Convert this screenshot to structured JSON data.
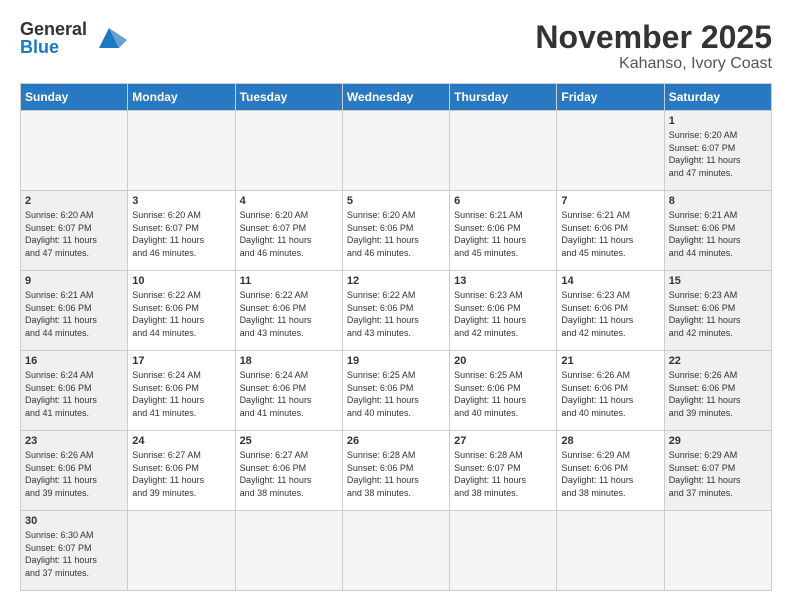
{
  "header": {
    "logo_line1": "General",
    "logo_line2": "Blue",
    "title": "November 2025",
    "subtitle": "Kahanso, Ivory Coast"
  },
  "days_of_week": [
    "Sunday",
    "Monday",
    "Tuesday",
    "Wednesday",
    "Thursday",
    "Friday",
    "Saturday"
  ],
  "weeks": [
    [
      {
        "day": "",
        "info": ""
      },
      {
        "day": "",
        "info": ""
      },
      {
        "day": "",
        "info": ""
      },
      {
        "day": "",
        "info": ""
      },
      {
        "day": "",
        "info": ""
      },
      {
        "day": "",
        "info": ""
      },
      {
        "day": "1",
        "info": "Sunrise: 6:20 AM\nSunset: 6:07 PM\nDaylight: 11 hours\nand 47 minutes."
      }
    ],
    [
      {
        "day": "2",
        "info": "Sunrise: 6:20 AM\nSunset: 6:07 PM\nDaylight: 11 hours\nand 47 minutes."
      },
      {
        "day": "3",
        "info": "Sunrise: 6:20 AM\nSunset: 6:07 PM\nDaylight: 11 hours\nand 46 minutes."
      },
      {
        "day": "4",
        "info": "Sunrise: 6:20 AM\nSunset: 6:07 PM\nDaylight: 11 hours\nand 46 minutes."
      },
      {
        "day": "5",
        "info": "Sunrise: 6:20 AM\nSunset: 6:06 PM\nDaylight: 11 hours\nand 46 minutes."
      },
      {
        "day": "6",
        "info": "Sunrise: 6:21 AM\nSunset: 6:06 PM\nDaylight: 11 hours\nand 45 minutes."
      },
      {
        "day": "7",
        "info": "Sunrise: 6:21 AM\nSunset: 6:06 PM\nDaylight: 11 hours\nand 45 minutes."
      },
      {
        "day": "8",
        "info": "Sunrise: 6:21 AM\nSunset: 6:06 PM\nDaylight: 11 hours\nand 44 minutes."
      }
    ],
    [
      {
        "day": "9",
        "info": "Sunrise: 6:21 AM\nSunset: 6:06 PM\nDaylight: 11 hours\nand 44 minutes."
      },
      {
        "day": "10",
        "info": "Sunrise: 6:22 AM\nSunset: 6:06 PM\nDaylight: 11 hours\nand 44 minutes."
      },
      {
        "day": "11",
        "info": "Sunrise: 6:22 AM\nSunset: 6:06 PM\nDaylight: 11 hours\nand 43 minutes."
      },
      {
        "day": "12",
        "info": "Sunrise: 6:22 AM\nSunset: 6:06 PM\nDaylight: 11 hours\nand 43 minutes."
      },
      {
        "day": "13",
        "info": "Sunrise: 6:23 AM\nSunset: 6:06 PM\nDaylight: 11 hours\nand 42 minutes."
      },
      {
        "day": "14",
        "info": "Sunrise: 6:23 AM\nSunset: 6:06 PM\nDaylight: 11 hours\nand 42 minutes."
      },
      {
        "day": "15",
        "info": "Sunrise: 6:23 AM\nSunset: 6:06 PM\nDaylight: 11 hours\nand 42 minutes."
      }
    ],
    [
      {
        "day": "16",
        "info": "Sunrise: 6:24 AM\nSunset: 6:06 PM\nDaylight: 11 hours\nand 41 minutes."
      },
      {
        "day": "17",
        "info": "Sunrise: 6:24 AM\nSunset: 6:06 PM\nDaylight: 11 hours\nand 41 minutes."
      },
      {
        "day": "18",
        "info": "Sunrise: 6:24 AM\nSunset: 6:06 PM\nDaylight: 11 hours\nand 41 minutes."
      },
      {
        "day": "19",
        "info": "Sunrise: 6:25 AM\nSunset: 6:06 PM\nDaylight: 11 hours\nand 40 minutes."
      },
      {
        "day": "20",
        "info": "Sunrise: 6:25 AM\nSunset: 6:06 PM\nDaylight: 11 hours\nand 40 minutes."
      },
      {
        "day": "21",
        "info": "Sunrise: 6:26 AM\nSunset: 6:06 PM\nDaylight: 11 hours\nand 40 minutes."
      },
      {
        "day": "22",
        "info": "Sunrise: 6:26 AM\nSunset: 6:06 PM\nDaylight: 11 hours\nand 39 minutes."
      }
    ],
    [
      {
        "day": "23",
        "info": "Sunrise: 6:26 AM\nSunset: 6:06 PM\nDaylight: 11 hours\nand 39 minutes."
      },
      {
        "day": "24",
        "info": "Sunrise: 6:27 AM\nSunset: 6:06 PM\nDaylight: 11 hours\nand 39 minutes."
      },
      {
        "day": "25",
        "info": "Sunrise: 6:27 AM\nSunset: 6:06 PM\nDaylight: 11 hours\nand 38 minutes."
      },
      {
        "day": "26",
        "info": "Sunrise: 6:28 AM\nSunset: 6:06 PM\nDaylight: 11 hours\nand 38 minutes."
      },
      {
        "day": "27",
        "info": "Sunrise: 6:28 AM\nSunset: 6:07 PM\nDaylight: 11 hours\nand 38 minutes."
      },
      {
        "day": "28",
        "info": "Sunrise: 6:29 AM\nSunset: 6:06 PM\nDaylight: 11 hours\nand 38 minutes."
      },
      {
        "day": "29",
        "info": "Sunrise: 6:29 AM\nSunset: 6:07 PM\nDaylight: 11 hours\nand 37 minutes."
      }
    ],
    [
      {
        "day": "30",
        "info": "Sunrise: 6:30 AM\nSunset: 6:07 PM\nDaylight: 11 hours\nand 37 minutes."
      },
      {
        "day": "",
        "info": ""
      },
      {
        "day": "",
        "info": ""
      },
      {
        "day": "",
        "info": ""
      },
      {
        "day": "",
        "info": ""
      },
      {
        "day": "",
        "info": ""
      },
      {
        "day": "",
        "info": ""
      }
    ]
  ]
}
